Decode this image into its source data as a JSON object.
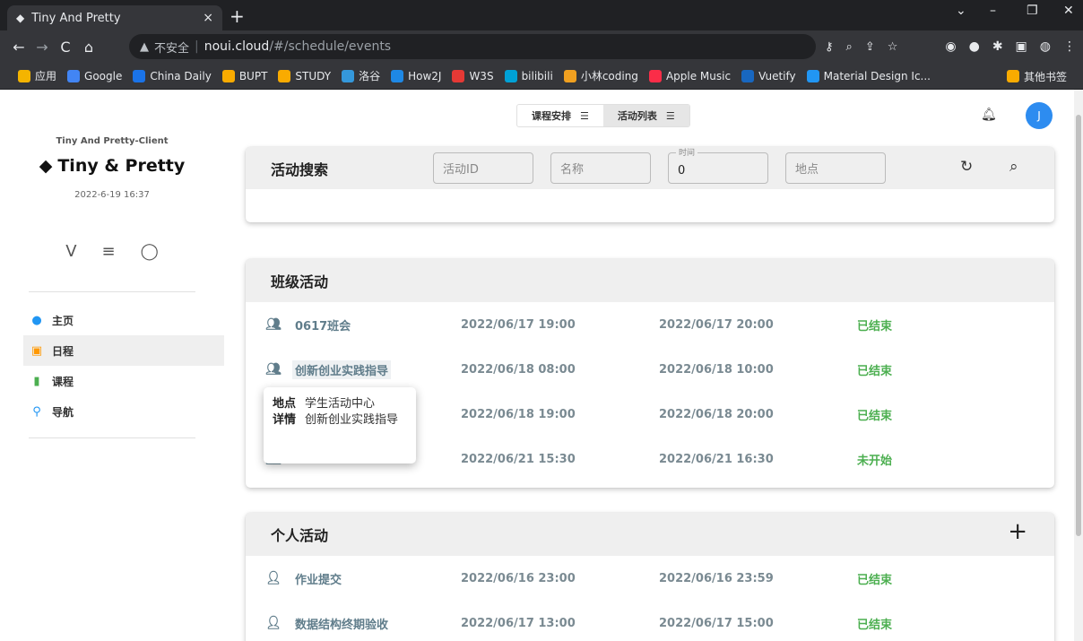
{
  "browser": {
    "tab_title": "Tiny And Pretty",
    "tab_close": "×",
    "new_tab": "+",
    "url_warning": "▲",
    "url_insecure": "不安全",
    "url_host": "noui.cloud",
    "url_path": "/#/schedule/events",
    "bookmarks": [
      {
        "label": "应用",
        "icon": "apps-icon",
        "color": "#f4b400"
      },
      {
        "label": "Google",
        "icon": "google-icon",
        "color": "#4285f4"
      },
      {
        "label": "China Daily",
        "icon": "chinadaily-icon",
        "color": "#1a73e8"
      },
      {
        "label": "BUPT",
        "icon": "folder-icon",
        "color": "#f9ab00"
      },
      {
        "label": "STUDY",
        "icon": "folder-icon",
        "color": "#f9ab00"
      },
      {
        "label": "洛谷",
        "icon": "luogu-icon",
        "color": "#3498db"
      },
      {
        "label": "How2J",
        "icon": "how2j-icon",
        "color": "#1e88e5"
      },
      {
        "label": "W3S",
        "icon": "w3s-icon",
        "color": "#e53935"
      },
      {
        "label": "bilibili",
        "icon": "bilibili-icon",
        "color": "#00a1d6"
      },
      {
        "label": "小林coding",
        "icon": "xiaolin-icon",
        "color": "#f0a020"
      },
      {
        "label": "Apple Music",
        "icon": "apple-music-icon",
        "color": "#fa2d48"
      },
      {
        "label": "Vuetify",
        "icon": "vuetify-icon",
        "color": "#1867c0"
      },
      {
        "label": "Material Design Ic...",
        "icon": "mdi-icon",
        "color": "#2196f3"
      }
    ],
    "other_bookmarks": "其他书签"
  },
  "sidebar": {
    "client_name": "Tiny And Pretty-Client",
    "app_title": "Tiny & Pretty",
    "date": "2022-6-19 16:37",
    "nav": [
      {
        "label": "主页",
        "icon": "account-circle-icon",
        "color": "#2196f3",
        "glyph": "●"
      },
      {
        "label": "日程",
        "icon": "calendar-icon",
        "color": "#ff9800",
        "glyph": "▣"
      },
      {
        "label": "课程",
        "icon": "book-icon",
        "color": "#4caf50",
        "glyph": "▮"
      },
      {
        "label": "导航",
        "icon": "map-marker-icon",
        "color": "#2196f3",
        "glyph": "⚲"
      }
    ]
  },
  "topbar": {
    "toggle_schedule": "课程安排",
    "toggle_events": "活动列表",
    "avatar_initial": "J"
  },
  "search": {
    "title": "活动搜索",
    "id_placeholder": "活动ID",
    "name_placeholder": "名称",
    "time_label": "时间",
    "time_value": "0",
    "place_placeholder": "地点"
  },
  "class_events": {
    "title": "班级活动",
    "rows": [
      {
        "name": "0617班会",
        "start": "2022/06/17 19:00",
        "end": "2022/06/17 20:00",
        "status": "已结束"
      },
      {
        "name": "创新创业实践指导",
        "start": "2022/06/18 08:00",
        "end": "2022/06/18 10:00",
        "status": "已结束"
      },
      {
        "name": "",
        "start": "2022/06/18 19:00",
        "end": "2022/06/18 20:00",
        "status": "已结束"
      },
      {
        "name": "",
        "start": "2022/06/21 15:30",
        "end": "2022/06/21 16:30",
        "status": "未开始"
      }
    ]
  },
  "tooltip": {
    "place_key": "地点",
    "place_value": "学生活动中心",
    "detail_key": "详情",
    "detail_value": "创新创业实践指导"
  },
  "personal_events": {
    "title": "个人活动",
    "add_label": "+",
    "rows": [
      {
        "name": "作业提交",
        "start": "2022/06/16 23:00",
        "end": "2022/06/16 23:59",
        "status": "已结束"
      },
      {
        "name": "数据结构终期验收",
        "start": "2022/06/17 13:00",
        "end": "2022/06/17 15:00",
        "status": "已结束"
      }
    ]
  }
}
